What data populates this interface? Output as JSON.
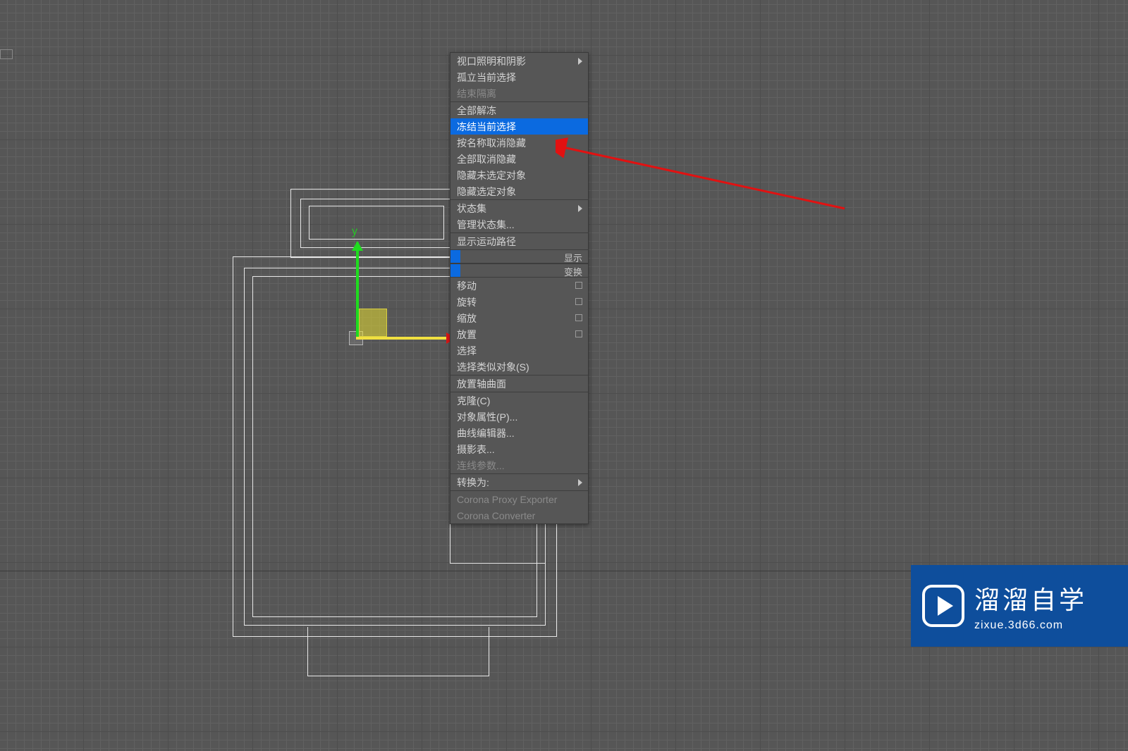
{
  "gizmo": {
    "y_label": "y"
  },
  "menu": {
    "group1": [
      {
        "label": "视口照明和阴影",
        "submenu": true
      },
      {
        "label": "孤立当前选择"
      },
      {
        "label": "结束隔离",
        "disabled": true
      }
    ],
    "group2": [
      {
        "label": "全部解冻"
      },
      {
        "label": "冻结当前选择",
        "highlight": true
      },
      {
        "label": "按名称取消隐藏"
      },
      {
        "label": "全部取消隐藏"
      },
      {
        "label": "隐藏未选定对象"
      },
      {
        "label": "隐藏选定对象"
      }
    ],
    "group3": [
      {
        "label": "状态集",
        "submenu": true
      },
      {
        "label": "管理状态集..."
      }
    ],
    "group4": [
      {
        "label": "显示运动路径"
      }
    ],
    "header1": "显示",
    "header2": "变换",
    "group5": [
      {
        "label": "移动",
        "check": true
      },
      {
        "label": "旋转",
        "check": true
      },
      {
        "label": "缩放",
        "check": true
      },
      {
        "label": "放置",
        "check": true
      },
      {
        "label": "选择"
      },
      {
        "label": "选择类似对象(S)"
      }
    ],
    "group6": [
      {
        "label": "放置轴曲面"
      }
    ],
    "group7": [
      {
        "label": "克隆(C)"
      },
      {
        "label": "对象属性(P)..."
      },
      {
        "label": "曲线编辑器..."
      },
      {
        "label": "摄影表..."
      },
      {
        "label": "连线参数...",
        "disabled": true
      }
    ],
    "group8": [
      {
        "label": "转换为:",
        "submenu": true
      }
    ],
    "group9": [
      {
        "label": "Corona Proxy Exporter",
        "disabled": true
      },
      {
        "label": "Corona Converter",
        "disabled": true
      }
    ]
  },
  "watermark": {
    "title": "溜溜自学",
    "sub": "zixue.3d66.com"
  }
}
